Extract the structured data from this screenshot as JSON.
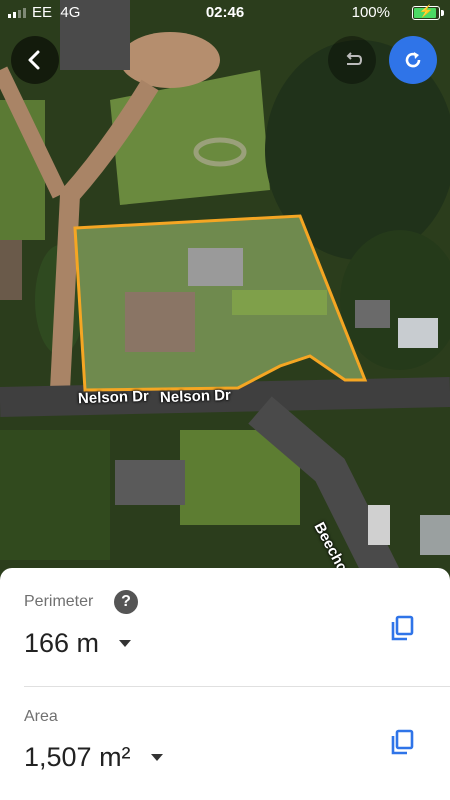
{
  "status_bar": {
    "carrier": "EE",
    "network": "4G",
    "time": "02:46",
    "battery_percent": "100%",
    "battery_level": 1.0
  },
  "map": {
    "roads": [
      "Nelson Dr",
      "Nelson Dr",
      "Beechcroft"
    ],
    "outline_color": "#f5a623"
  },
  "toolbar": {
    "back_icon": "chevron-left-icon",
    "undo_icon": "undo-icon",
    "redo_icon": "redo-icon",
    "accent_color": "#2f74e8"
  },
  "measure": {
    "perimeter_label": "Perimeter",
    "perimeter_value": "166 m",
    "area_label": "Area",
    "area_value": "1,507 m²",
    "help_glyph": "?"
  }
}
